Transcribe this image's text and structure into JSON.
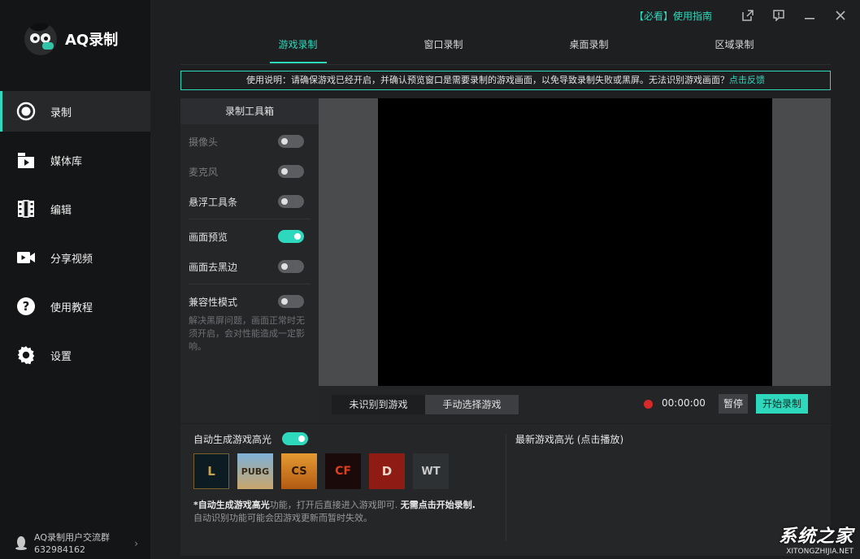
{
  "app": {
    "logo_text": "AQ录制"
  },
  "sidebar": {
    "items": [
      {
        "label": "录制",
        "icon": "record-icon",
        "active": true
      },
      {
        "label": "媒体库",
        "icon": "media-library-icon"
      },
      {
        "label": "编辑",
        "icon": "film-edit-icon"
      },
      {
        "label": "分享视频",
        "icon": "video-camera-icon"
      },
      {
        "label": "使用教程",
        "icon": "question-icon"
      },
      {
        "label": "设置",
        "icon": "gear-icon"
      }
    ],
    "group": {
      "name": "AQ录制用户交流群",
      "number": "632984162"
    }
  },
  "topbar": {
    "guide_tag": "【必看】",
    "guide_label": "使用指南"
  },
  "tabs": [
    {
      "label": "游戏录制",
      "active": true
    },
    {
      "label": "窗口录制"
    },
    {
      "label": "桌面录制"
    },
    {
      "label": "区域录制"
    }
  ],
  "notice": {
    "text": "使用说明：请确保游戏已经开启，并确认预览窗口是需要录制的游戏画面，以免导致录制失败或黑屏。无法识别游戏画面？",
    "link": "点击反馈"
  },
  "toolbox": {
    "title": "录制工具箱",
    "options": [
      {
        "label": "摄像头",
        "on": false,
        "disabled": true
      },
      {
        "label": "麦克风",
        "on": false,
        "disabled": true
      },
      {
        "label": "悬浮工具条",
        "on": false
      },
      {
        "label": "画面预览",
        "on": true
      },
      {
        "label": "画面去黑边",
        "on": false
      },
      {
        "label": "兼容性模式",
        "on": false
      }
    ],
    "compat_desc": "解决黑屏问题，画面正常时无须开启，会对性能造成一定影响。"
  },
  "recording": {
    "detect_unrecognized": "未识别到游戏",
    "detect_manual": "手动选择游戏",
    "timer": "00:00:00",
    "pause_label": "暂停",
    "start_label": "开始录制"
  },
  "highlights": {
    "title": "自动生成游戏高光",
    "enabled": true,
    "games": [
      {
        "icon": "league-of-legends-icon",
        "glyph": "L"
      },
      {
        "icon": "pubg-icon",
        "glyph": "PUBG"
      },
      {
        "icon": "counter-strike-icon",
        "glyph": "CS"
      },
      {
        "icon": "crossfire-icon",
        "glyph": "CF"
      },
      {
        "icon": "dota2-icon",
        "glyph": "D"
      },
      {
        "icon": "world-of-tanks-icon",
        "glyph": "WT"
      }
    ],
    "note_bold1": "*自动生成游戏高光",
    "note_mid": "功能，打开后直接进入游戏即可. ",
    "note_bold2": "无需点击开始录制.",
    "note_line2": "自动识别功能可能会因游戏更新而暂时失效。",
    "latest_title": "最新游戏高光 (点击播放)"
  },
  "watermark": {
    "top": "系统之家",
    "bottom": "XITONGZHIJIA.NET"
  },
  "colors": {
    "accent": "#2ed8bd",
    "record_dot": "#d62a2a",
    "sidebar_bg": "#141516",
    "main_bg": "#1e1f21"
  }
}
